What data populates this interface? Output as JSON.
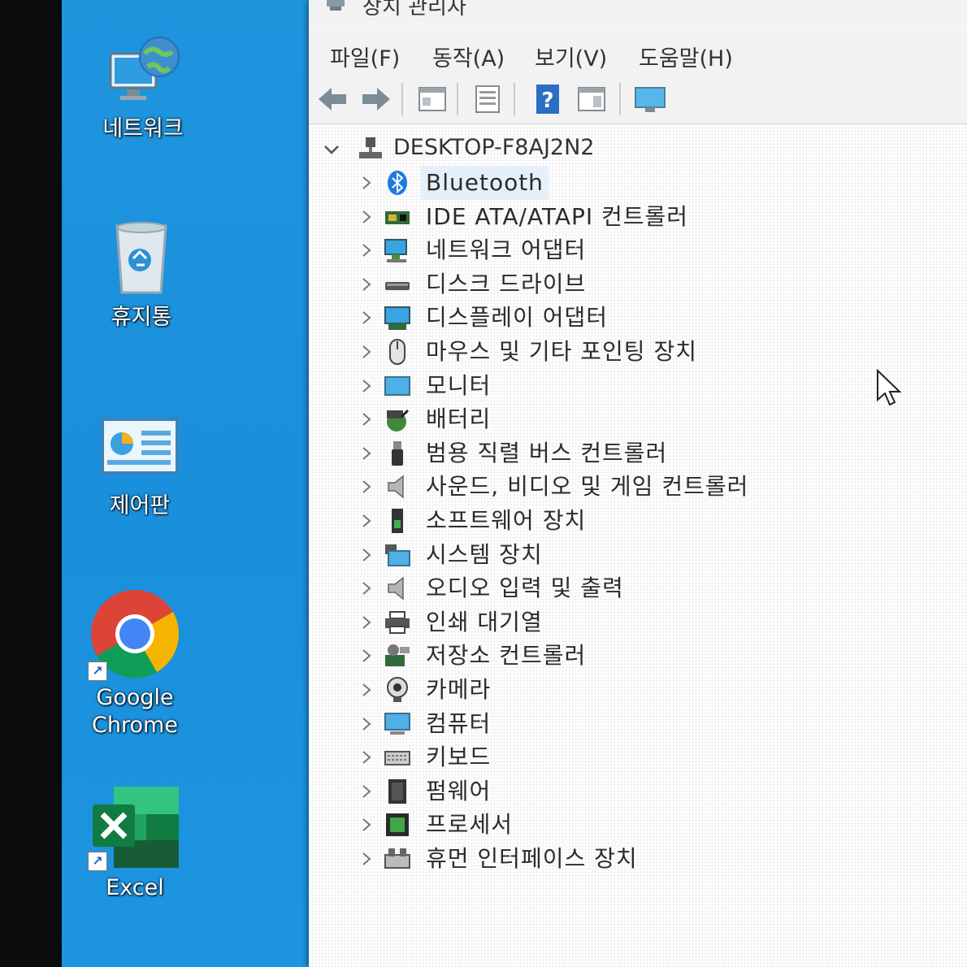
{
  "desktop": {
    "icons": [
      {
        "label": "네트워크",
        "name": "network-icon"
      },
      {
        "label": "휴지통",
        "name": "recycle-bin-icon"
      },
      {
        "label": "제어판",
        "name": "control-panel-icon"
      },
      {
        "label": "Google\nChrome",
        "name": "chrome-icon"
      },
      {
        "label": "Excel",
        "name": "excel-icon"
      }
    ]
  },
  "window": {
    "title": "장치 관리자",
    "menu": [
      "파일(F)",
      "동작(A)",
      "보기(V)",
      "도움말(H)"
    ],
    "toolbar": [
      "back-icon",
      "forward-icon",
      "properties-icon",
      "show-hide-console-tree-icon",
      "help-icon",
      "action-pane-icon",
      "monitor-icon"
    ]
  },
  "tree": {
    "root": "DESKTOP-F8AJ2N2",
    "nodes": [
      {
        "label": "Bluetooth",
        "icon": "bluetooth-icon"
      },
      {
        "label": "IDE ATA/ATAPI 컨트롤러",
        "icon": "ide-controller-icon"
      },
      {
        "label": "네트워크 어댑터",
        "icon": "network-adapter-icon"
      },
      {
        "label": "디스크 드라이브",
        "icon": "disk-drive-icon"
      },
      {
        "label": "디스플레이 어댑터",
        "icon": "display-adapter-icon"
      },
      {
        "label": "마우스 및 기타 포인팅 장치",
        "icon": "mouse-icon"
      },
      {
        "label": "모니터",
        "icon": "monitor-icon"
      },
      {
        "label": "배터리",
        "icon": "battery-icon"
      },
      {
        "label": "범용 직렬 버스 컨트롤러",
        "icon": "usb-icon"
      },
      {
        "label": "사운드, 비디오 및 게임 컨트롤러",
        "icon": "sound-icon"
      },
      {
        "label": "소프트웨어 장치",
        "icon": "software-device-icon"
      },
      {
        "label": "시스템 장치",
        "icon": "system-device-icon"
      },
      {
        "label": "오디오 입력 및 출력",
        "icon": "audio-icon"
      },
      {
        "label": "인쇄 대기열",
        "icon": "printer-icon"
      },
      {
        "label": "저장소 컨트롤러",
        "icon": "storage-controller-icon"
      },
      {
        "label": "카메라",
        "icon": "camera-icon"
      },
      {
        "label": "컴퓨터",
        "icon": "computer-icon"
      },
      {
        "label": "키보드",
        "icon": "keyboard-icon"
      },
      {
        "label": "펌웨어",
        "icon": "firmware-icon"
      },
      {
        "label": "프로세서",
        "icon": "processor-icon"
      },
      {
        "label": "휴먼 인터페이스 장치",
        "icon": "hid-icon"
      }
    ]
  }
}
